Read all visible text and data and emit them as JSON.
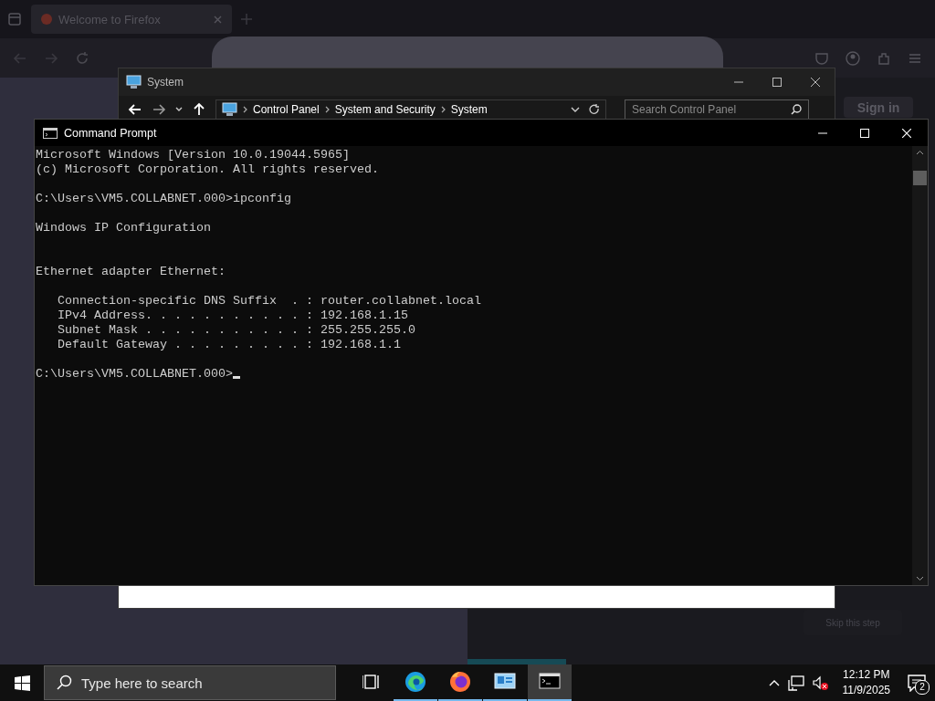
{
  "browser": {
    "tabs": [
      {
        "label": "Welcome to Firefox",
        "selected": true
      }
    ],
    "sign_in": "Sign in",
    "skip": "Skip this step",
    "progress": {
      "level": 0.21
    }
  },
  "system_window": {
    "title": "System",
    "breadcrumbs": [
      "Control Panel",
      "System and Security",
      "System"
    ],
    "search": {
      "placeholder": "Search Control Panel"
    }
  },
  "command_prompt": {
    "title": "Command Prompt",
    "paragraphs": [
      {
        "kind": "normal",
        "lines": [
          "Microsoft Windows [Version 10.0.19044.5965]",
          "(c) Microsoft Corporation. All rights reserved."
        ]
      },
      {
        "kind": "normal",
        "lines": [
          "C:\\Users\\VM5.COLLABNET.000>ipconfig"
        ]
      },
      {
        "kind": "wide-gap",
        "lines": [
          "Windows IP Configuration"
        ]
      },
      {
        "kind": "normal",
        "lines": [
          "Ethernet adapter Ethernet:"
        ]
      },
      {
        "kind": "normal",
        "lines": [
          "   Connection-specific DNS Suffix  . : router.collabnet.local",
          "   IPv4 Address. . . . . . . . . . . : 192.168.1.15",
          "   Subnet Mask . . . . . . . . . . . : 255.255.255.0",
          "   Default Gateway . . . . . . . . . : 192.168.1.1"
        ]
      },
      {
        "kind": "prompt",
        "lines": [
          "C:\\Users\\VM5.COLLABNET.000>"
        ]
      }
    ]
  },
  "taskbar": {
    "search": {
      "placeholder": "Type here to search"
    },
    "apps": [
      {
        "kind": "task-view",
        "running": false,
        "selected": false
      },
      {
        "kind": "edge",
        "running": true,
        "selected": false
      },
      {
        "kind": "firefox",
        "running": true,
        "selected": false
      },
      {
        "kind": "control-panel",
        "running": true,
        "selected": false
      },
      {
        "kind": "terminal",
        "running": true,
        "selected": true
      }
    ],
    "time": "12:12 PM",
    "date": "11/9/2025",
    "notifications": "2"
  }
}
